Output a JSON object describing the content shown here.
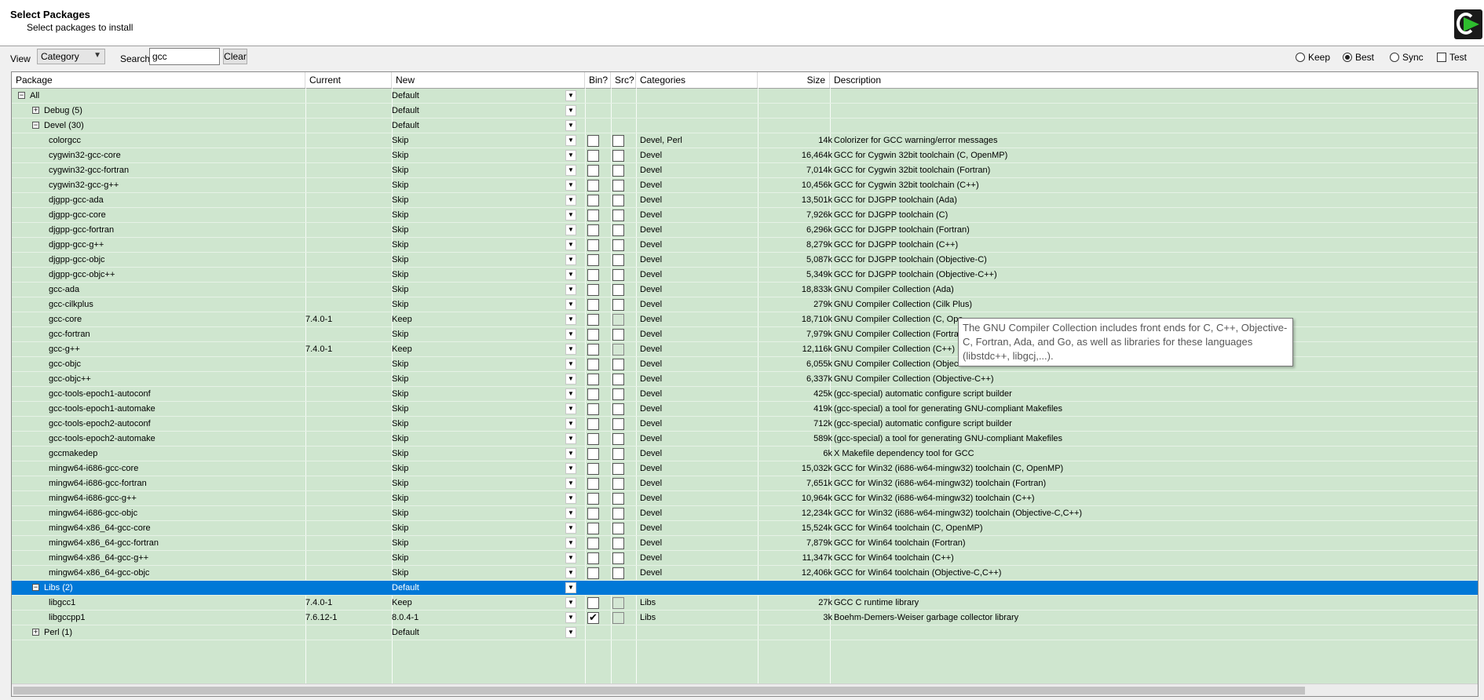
{
  "header": {
    "title": "Select Packages",
    "subtitle": "Select packages to install"
  },
  "toolbar": {
    "view_label": "View",
    "view_value": "Category",
    "search_label": "Search",
    "search_value": "gcc",
    "clear_label": "Clear",
    "options": [
      {
        "label": "Keep",
        "type": "radio",
        "selected": false
      },
      {
        "label": "Best",
        "type": "radio",
        "selected": true
      },
      {
        "label": "Sync",
        "type": "radio",
        "selected": false
      },
      {
        "label": "Test",
        "type": "checkbox",
        "selected": false
      }
    ]
  },
  "columns": [
    "Package",
    "Current",
    "New",
    "Bin?",
    "Src?",
    "Categories",
    "Size",
    "Description"
  ],
  "rows": [
    {
      "pkg": "All",
      "level": 0,
      "expander": "−",
      "cur": "",
      "new": "Default",
      "cb": false,
      "bin": null,
      "src": null,
      "cat": "",
      "size": "",
      "desc": ""
    },
    {
      "pkg": "Debug (5)",
      "level": 1,
      "expander": "+",
      "cur": "",
      "new": "Default",
      "cb": false,
      "bin": null,
      "src": null,
      "cat": "",
      "size": "",
      "desc": ""
    },
    {
      "pkg": "Devel (30)",
      "level": 1,
      "expander": "−",
      "cur": "",
      "new": "Default",
      "cb": false,
      "bin": null,
      "src": null,
      "cat": "",
      "size": "",
      "desc": ""
    },
    {
      "pkg": "colorgcc",
      "level": 2,
      "cur": "",
      "new": "Skip",
      "cb": true,
      "bin": "empty",
      "src": "empty",
      "cat": "Devel, Perl",
      "size": "14k",
      "desc": "Colorizer for GCC warning/error messages"
    },
    {
      "pkg": "cygwin32-gcc-core",
      "level": 2,
      "cur": "",
      "new": "Skip",
      "cb": true,
      "bin": "empty",
      "src": "empty",
      "cat": "Devel",
      "size": "16,464k",
      "desc": "GCC for Cygwin 32bit toolchain (C, OpenMP)"
    },
    {
      "pkg": "cygwin32-gcc-fortran",
      "level": 2,
      "cur": "",
      "new": "Skip",
      "cb": true,
      "bin": "empty",
      "src": "empty",
      "cat": "Devel",
      "size": "7,014k",
      "desc": "GCC for Cygwin 32bit toolchain (Fortran)"
    },
    {
      "pkg": "cygwin32-gcc-g++",
      "level": 2,
      "cur": "",
      "new": "Skip",
      "cb": true,
      "bin": "empty",
      "src": "empty",
      "cat": "Devel",
      "size": "10,456k",
      "desc": "GCC for Cygwin 32bit toolchain (C++)"
    },
    {
      "pkg": "djgpp-gcc-ada",
      "level": 2,
      "cur": "",
      "new": "Skip",
      "cb": true,
      "bin": "empty",
      "src": "empty",
      "cat": "Devel",
      "size": "13,501k",
      "desc": "GCC for DJGPP toolchain (Ada)"
    },
    {
      "pkg": "djgpp-gcc-core",
      "level": 2,
      "cur": "",
      "new": "Skip",
      "cb": true,
      "bin": "empty",
      "src": "empty",
      "cat": "Devel",
      "size": "7,926k",
      "desc": "GCC for DJGPP toolchain (C)"
    },
    {
      "pkg": "djgpp-gcc-fortran",
      "level": 2,
      "cur": "",
      "new": "Skip",
      "cb": true,
      "bin": "empty",
      "src": "empty",
      "cat": "Devel",
      "size": "6,296k",
      "desc": "GCC for DJGPP toolchain (Fortran)"
    },
    {
      "pkg": "djgpp-gcc-g++",
      "level": 2,
      "cur": "",
      "new": "Skip",
      "cb": true,
      "bin": "empty",
      "src": "empty",
      "cat": "Devel",
      "size": "8,279k",
      "desc": "GCC for DJGPP toolchain (C++)"
    },
    {
      "pkg": "djgpp-gcc-objc",
      "level": 2,
      "cur": "",
      "new": "Skip",
      "cb": true,
      "bin": "empty",
      "src": "empty",
      "cat": "Devel",
      "size": "5,087k",
      "desc": "GCC for DJGPP toolchain (Objective-C)"
    },
    {
      "pkg": "djgpp-gcc-objc++",
      "level": 2,
      "cur": "",
      "new": "Skip",
      "cb": true,
      "bin": "empty",
      "src": "empty",
      "cat": "Devel",
      "size": "5,349k",
      "desc": "GCC for DJGPP toolchain (Objective-C++)"
    },
    {
      "pkg": "gcc-ada",
      "level": 2,
      "cur": "",
      "new": "Skip",
      "cb": true,
      "bin": "empty",
      "src": "empty",
      "cat": "Devel",
      "size": "18,833k",
      "desc": "GNU Compiler Collection (Ada)"
    },
    {
      "pkg": "gcc-cilkplus",
      "level": 2,
      "cur": "",
      "new": "Skip",
      "cb": true,
      "bin": "empty",
      "src": "empty",
      "cat": "Devel",
      "size": "279k",
      "desc": "GNU Compiler Collection (Cilk Plus)"
    },
    {
      "pkg": "gcc-core",
      "level": 2,
      "cur": "7.4.0-1",
      "new": "Keep",
      "cb": true,
      "bin": "empty",
      "src": "dim",
      "cat": "Devel",
      "size": "18,710k",
      "desc": "GNU Compiler Collection (C, Ope"
    },
    {
      "pkg": "gcc-fortran",
      "level": 2,
      "cur": "",
      "new": "Skip",
      "cb": true,
      "bin": "empty",
      "src": "empty",
      "cat": "Devel",
      "size": "7,979k",
      "desc": "GNU Compiler Collection (Fortran"
    },
    {
      "pkg": "gcc-g++",
      "level": 2,
      "cur": "7.4.0-1",
      "new": "Keep",
      "cb": true,
      "bin": "empty",
      "src": "dim",
      "cat": "Devel",
      "size": "12,116k",
      "desc": "GNU Compiler Collection (C++)"
    },
    {
      "pkg": "gcc-objc",
      "level": 2,
      "cur": "",
      "new": "Skip",
      "cb": true,
      "bin": "empty",
      "src": "empty",
      "cat": "Devel",
      "size": "6,055k",
      "desc": "GNU Compiler Collection (Objectiv"
    },
    {
      "pkg": "gcc-objc++",
      "level": 2,
      "cur": "",
      "new": "Skip",
      "cb": true,
      "bin": "empty",
      "src": "empty",
      "cat": "Devel",
      "size": "6,337k",
      "desc": "GNU Compiler Collection (Objective-C++)"
    },
    {
      "pkg": "gcc-tools-epoch1-autoconf",
      "level": 2,
      "cur": "",
      "new": "Skip",
      "cb": true,
      "bin": "empty",
      "src": "empty",
      "cat": "Devel",
      "size": "425k",
      "desc": "(gcc-special) automatic configure script builder"
    },
    {
      "pkg": "gcc-tools-epoch1-automake",
      "level": 2,
      "cur": "",
      "new": "Skip",
      "cb": true,
      "bin": "empty",
      "src": "empty",
      "cat": "Devel",
      "size": "419k",
      "desc": "(gcc-special) a tool for generating GNU-compliant Makefiles"
    },
    {
      "pkg": "gcc-tools-epoch2-autoconf",
      "level": 2,
      "cur": "",
      "new": "Skip",
      "cb": true,
      "bin": "empty",
      "src": "empty",
      "cat": "Devel",
      "size": "712k",
      "desc": "(gcc-special) automatic configure script builder"
    },
    {
      "pkg": "gcc-tools-epoch2-automake",
      "level": 2,
      "cur": "",
      "new": "Skip",
      "cb": true,
      "bin": "empty",
      "src": "empty",
      "cat": "Devel",
      "size": "589k",
      "desc": "(gcc-special) a tool for generating GNU-compliant Makefiles"
    },
    {
      "pkg": "gccmakedep",
      "level": 2,
      "cur": "",
      "new": "Skip",
      "cb": true,
      "bin": "empty",
      "src": "empty",
      "cat": "Devel",
      "size": "6k",
      "desc": "X Makefile dependency tool for GCC"
    },
    {
      "pkg": "mingw64-i686-gcc-core",
      "level": 2,
      "cur": "",
      "new": "Skip",
      "cb": true,
      "bin": "empty",
      "src": "empty",
      "cat": "Devel",
      "size": "15,032k",
      "desc": "GCC for Win32 (i686-w64-mingw32) toolchain (C, OpenMP)"
    },
    {
      "pkg": "mingw64-i686-gcc-fortran",
      "level": 2,
      "cur": "",
      "new": "Skip",
      "cb": true,
      "bin": "empty",
      "src": "empty",
      "cat": "Devel",
      "size": "7,651k",
      "desc": "GCC for Win32 (i686-w64-mingw32) toolchain (Fortran)"
    },
    {
      "pkg": "mingw64-i686-gcc-g++",
      "level": 2,
      "cur": "",
      "new": "Skip",
      "cb": true,
      "bin": "empty",
      "src": "empty",
      "cat": "Devel",
      "size": "10,964k",
      "desc": "GCC for Win32 (i686-w64-mingw32) toolchain (C++)"
    },
    {
      "pkg": "mingw64-i686-gcc-objc",
      "level": 2,
      "cur": "",
      "new": "Skip",
      "cb": true,
      "bin": "empty",
      "src": "empty",
      "cat": "Devel",
      "size": "12,234k",
      "desc": "GCC for Win32 (i686-w64-mingw32) toolchain (Objective-C,C++)"
    },
    {
      "pkg": "mingw64-x86_64-gcc-core",
      "level": 2,
      "cur": "",
      "new": "Skip",
      "cb": true,
      "bin": "empty",
      "src": "empty",
      "cat": "Devel",
      "size": "15,524k",
      "desc": "GCC for Win64 toolchain (C, OpenMP)"
    },
    {
      "pkg": "mingw64-x86_64-gcc-fortran",
      "level": 2,
      "cur": "",
      "new": "Skip",
      "cb": true,
      "bin": "empty",
      "src": "empty",
      "cat": "Devel",
      "size": "7,879k",
      "desc": "GCC for Win64 toolchain (Fortran)"
    },
    {
      "pkg": "mingw64-x86_64-gcc-g++",
      "level": 2,
      "cur": "",
      "new": "Skip",
      "cb": true,
      "bin": "empty",
      "src": "empty",
      "cat": "Devel",
      "size": "11,347k",
      "desc": "GCC for Win64 toolchain (C++)"
    },
    {
      "pkg": "mingw64-x86_64-gcc-objc",
      "level": 2,
      "cur": "",
      "new": "Skip",
      "cb": true,
      "bin": "empty",
      "src": "empty",
      "cat": "Devel",
      "size": "12,406k",
      "desc": "GCC for Win64 toolchain (Objective-C,C++)"
    },
    {
      "pkg": "Libs (2)",
      "level": 1,
      "expander": "−",
      "cur": "",
      "new": "Default",
      "cb": false,
      "bin": null,
      "src": null,
      "cat": "",
      "size": "",
      "desc": "",
      "selected": true
    },
    {
      "pkg": "libgcc1",
      "level": 2,
      "cur": "7.4.0-1",
      "new": "Keep",
      "cb": true,
      "bin": "empty",
      "src": "dim",
      "cat": "Libs",
      "size": "27k",
      "desc": "GCC C runtime library"
    },
    {
      "pkg": "libgccpp1",
      "level": 2,
      "cur": "7.6.12-1",
      "new": "8.0.4-1",
      "cb": true,
      "bin": "checked",
      "src": "dim",
      "cat": "Libs",
      "size": "3k",
      "desc": "Boehm-Demers-Weiser garbage collector library"
    },
    {
      "pkg": "Perl (1)",
      "level": 1,
      "expander": "+",
      "cur": "",
      "new": "Default",
      "cb": false,
      "bin": null,
      "src": null,
      "cat": "",
      "size": "",
      "desc": ""
    }
  ],
  "tooltip": {
    "text": "The GNU Compiler Collection includes front ends for C, C++, Objective-C, Fortran, Ada, and Go, as well as libraries for these languages (libstdc++, libgcj,...)."
  },
  "colors": {
    "grid_background": "#cfe6cf",
    "selection": "#0078d7",
    "logo_arrow": "#2ebd2e"
  }
}
